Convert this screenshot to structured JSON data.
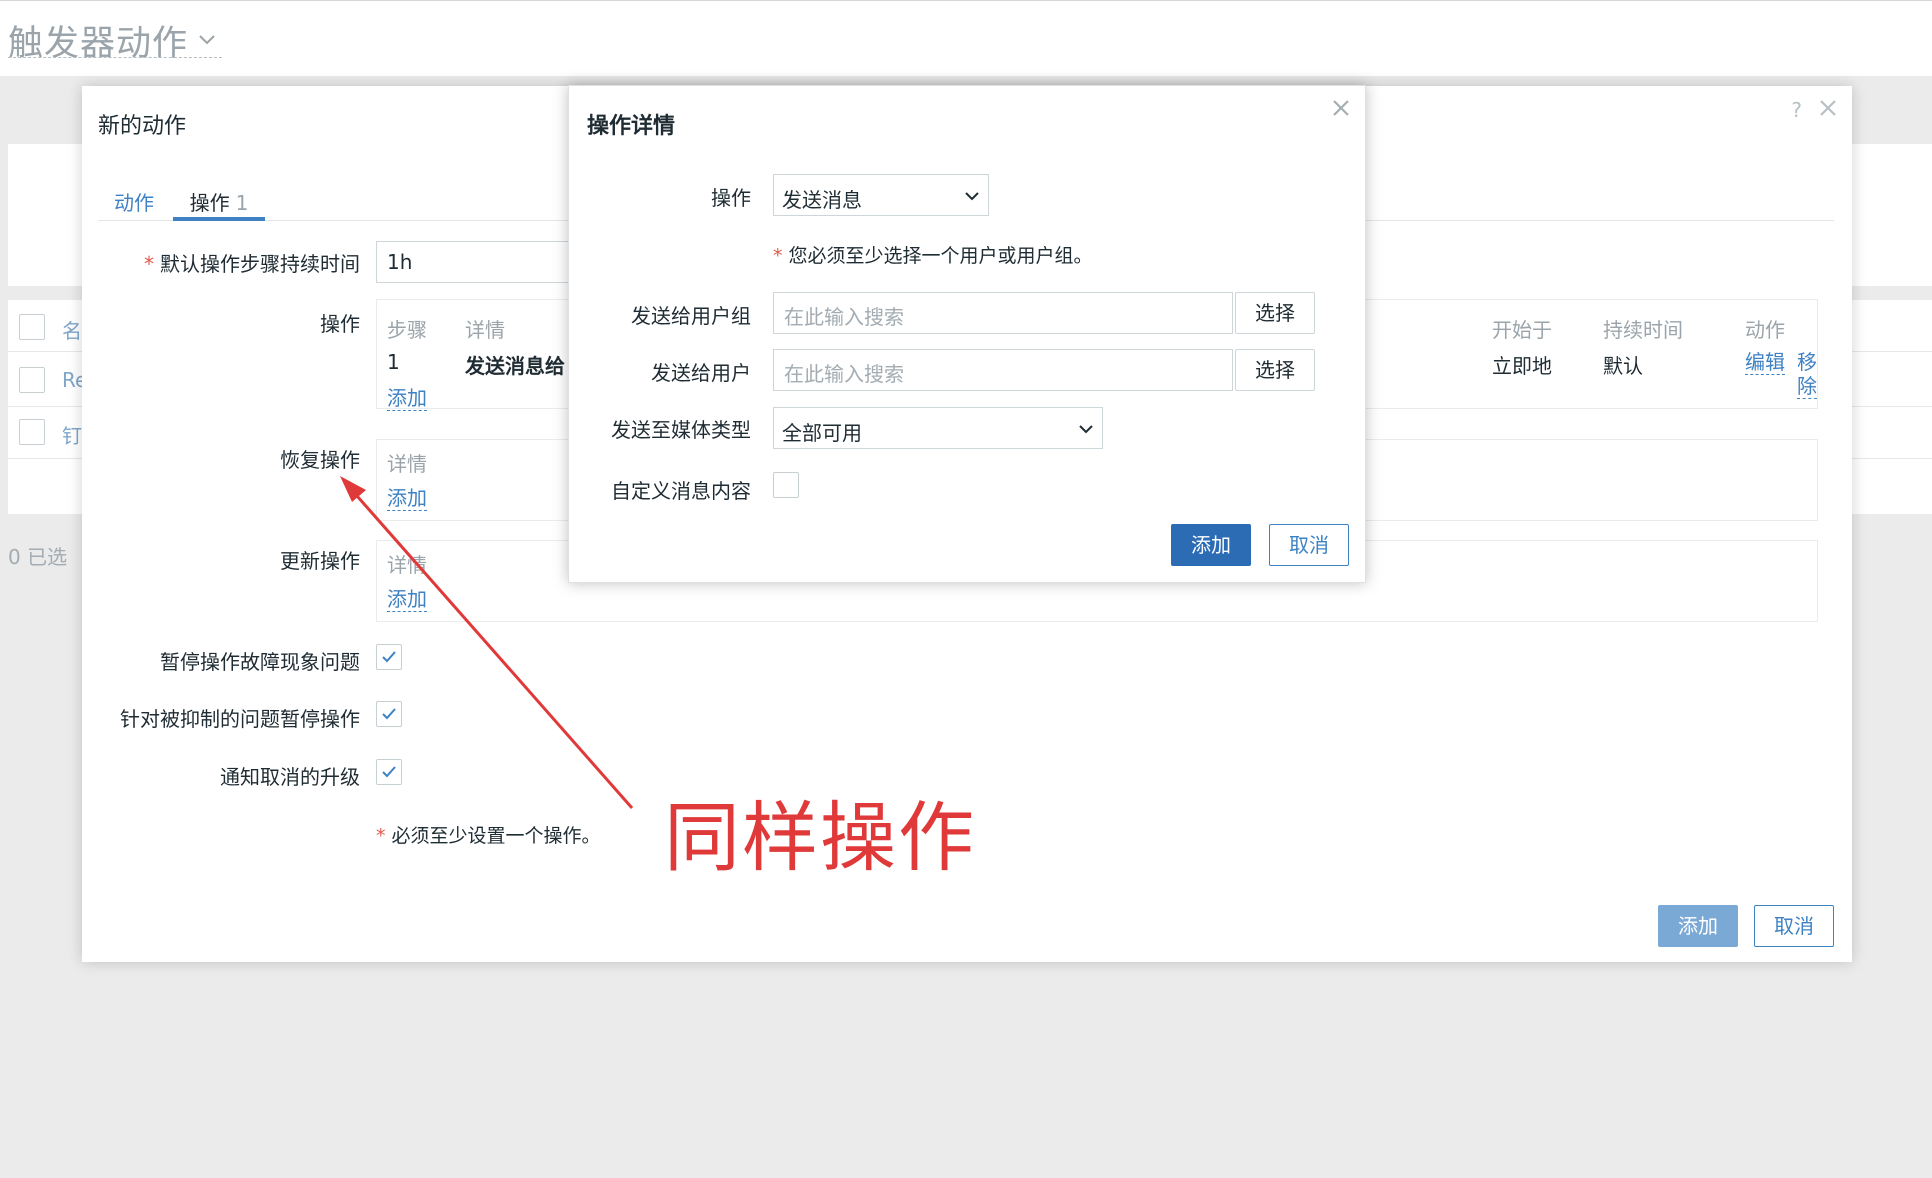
{
  "page": {
    "title": "触发器动作",
    "selected_count": "0 已选"
  },
  "background_list": {
    "rows": [
      "名",
      "Re",
      "钉"
    ]
  },
  "modal": {
    "title": "新的动作",
    "help": "?",
    "tabs": {
      "action": "动作",
      "operations": "操作",
      "operations_count": "1"
    },
    "default_duration": {
      "label": "默认操作步骤持续时间",
      "value": "1h"
    },
    "operations": {
      "label": "操作",
      "columns": {
        "step": "步骤",
        "details": "详情",
        "start_in": "开始于",
        "duration": "持续时间",
        "action": "动作"
      },
      "rows": [
        {
          "step": "1",
          "details": "发送消息给",
          "start_in": "立即地",
          "duration": "默认",
          "edit": "编辑",
          "remove": "移除"
        }
      ],
      "add": "添加"
    },
    "recovery": {
      "label": "恢复操作",
      "col_details": "详情",
      "add": "添加"
    },
    "update": {
      "label": "更新操作",
      "col_details": "详情",
      "add": "添加"
    },
    "pause_symptoms": {
      "label": "暂停操作故障现象问题",
      "checked": true
    },
    "pause_suppressed": {
      "label": "针对被抑制的问题暂停操作",
      "checked": true
    },
    "notify_cancelled": {
      "label": "通知取消的升级",
      "checked": true
    },
    "required_note": "必须至少设置一个操作。",
    "buttons": {
      "add": "添加",
      "cancel": "取消"
    }
  },
  "dialog": {
    "title": "操作详情",
    "operation": {
      "label": "操作",
      "value": "发送消息"
    },
    "required_note": "您必须至少选择一个用户或用户组。",
    "send_to_groups": {
      "label": "发送给用户组",
      "placeholder": "在此输入搜索",
      "button": "选择"
    },
    "send_to_users": {
      "label": "发送给用户",
      "placeholder": "在此输入搜索",
      "button": "选择"
    },
    "media_type": {
      "label": "发送至媒体类型",
      "value": "全部可用"
    },
    "custom_message": {
      "label": "自定义消息内容",
      "checked": false
    },
    "buttons": {
      "add": "添加",
      "cancel": "取消"
    }
  },
  "annotation": {
    "text": "同样操作",
    "color": "#e0393a"
  },
  "colors": {
    "link": "#3e82c4",
    "primary": "#2b6cb5",
    "required": "#e25a4a"
  }
}
